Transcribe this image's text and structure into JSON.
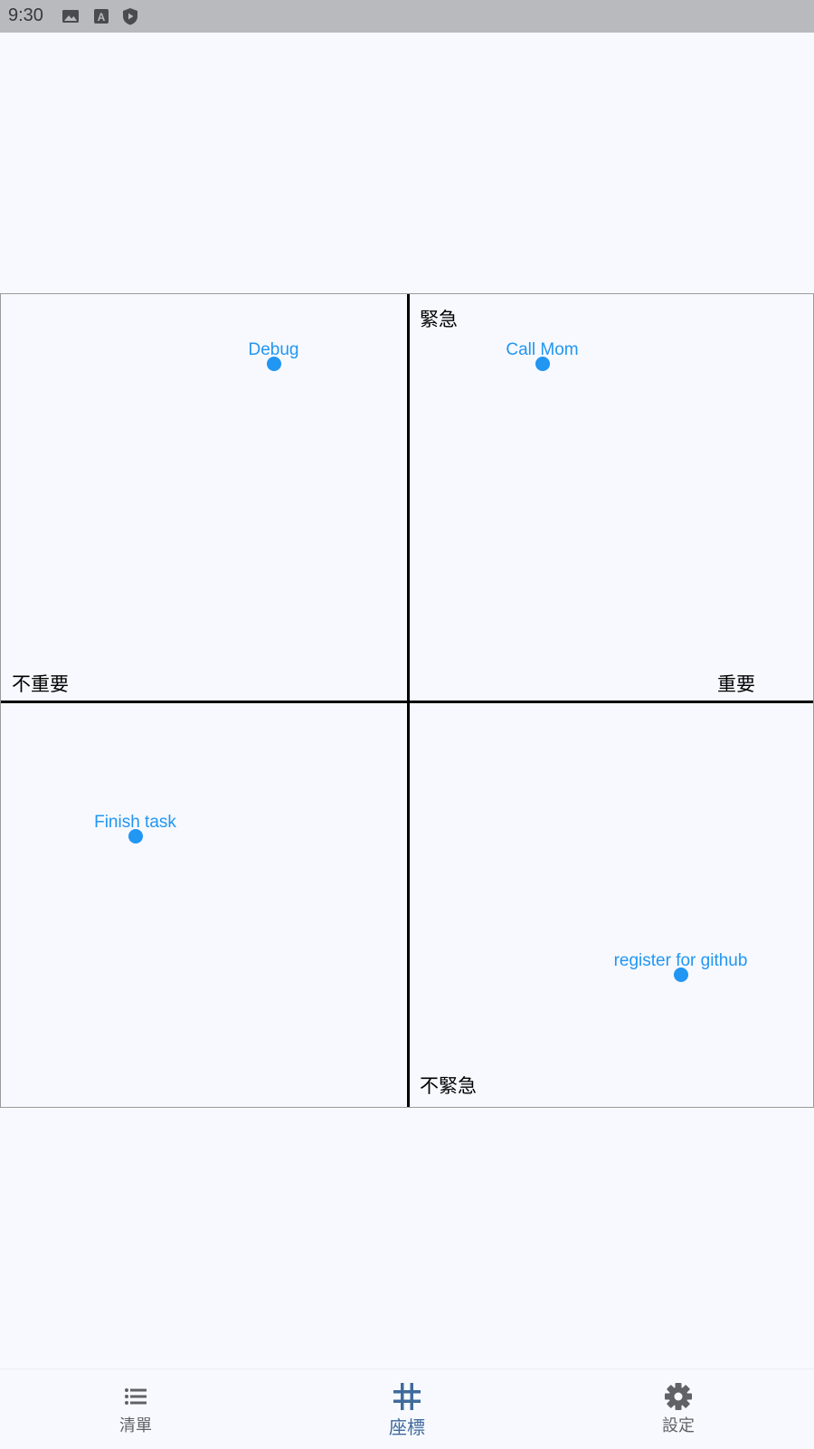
{
  "status_bar": {
    "time": "9:30",
    "icons": [
      "image-icon",
      "text-icon",
      "shield-play-icon"
    ]
  },
  "matrix": {
    "labels": {
      "urgent": "緊急",
      "not_urgent": "不緊急",
      "not_important": "不重要",
      "important": "重要"
    },
    "tasks": [
      {
        "name": "Debug",
        "importance": -0.33,
        "urgency": 0.83
      },
      {
        "name": "Call Mom",
        "importance": 0.33,
        "urgency": 0.83
      },
      {
        "name": "Finish task",
        "importance": -0.67,
        "urgency": -0.33
      },
      {
        "name": "register for github",
        "importance": 0.67,
        "urgency": -0.67
      }
    ]
  },
  "bottom_nav": {
    "items": [
      {
        "label": "清單",
        "icon": "list-icon",
        "active": false
      },
      {
        "label": "座標",
        "icon": "grid-icon",
        "active": true
      },
      {
        "label": "設定",
        "icon": "gear-icon",
        "active": false
      }
    ]
  },
  "colors": {
    "accent": "#2196f3",
    "active_nav": "#3f6a9c",
    "inactive_nav": "#616266",
    "background": "#f7f9fe",
    "status_bar": "#b9babe"
  }
}
